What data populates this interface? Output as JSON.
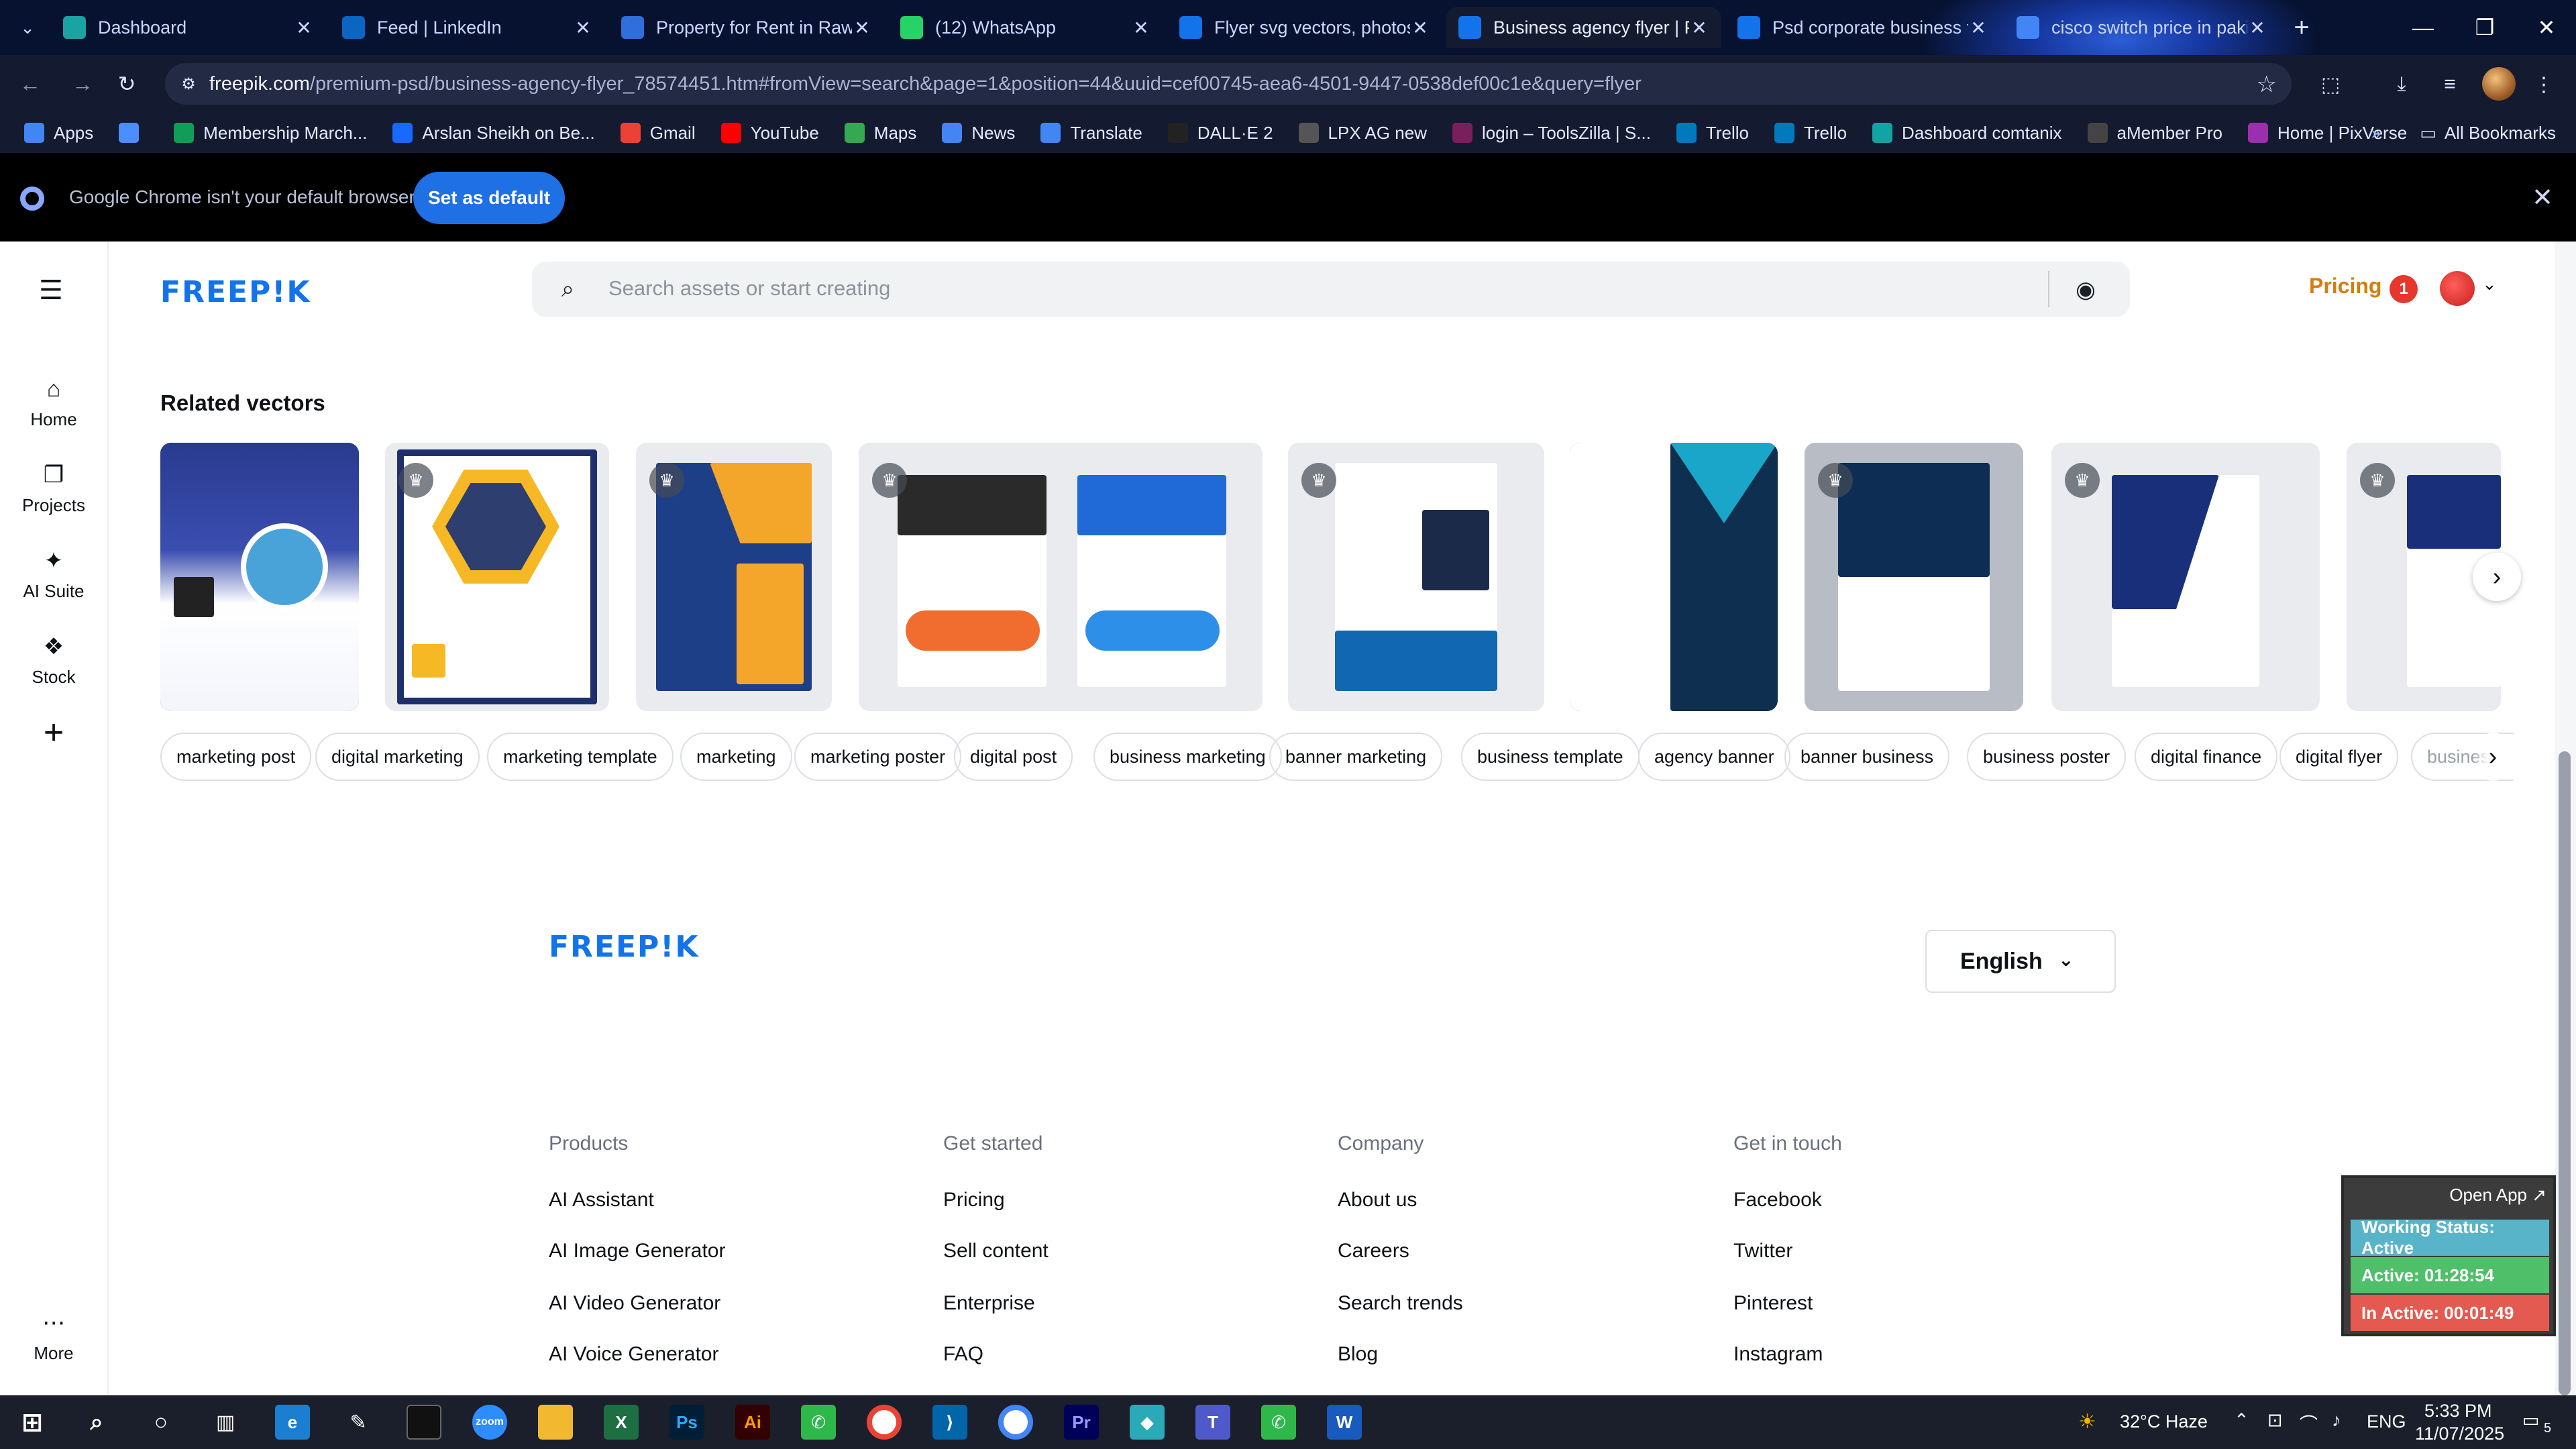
{
  "browser": {
    "tabs": [
      {
        "title": "Dashboard",
        "icon": "globe-icon",
        "color": "#1aa3a3"
      },
      {
        "title": "Feed | LinkedIn",
        "icon": "linkedin-icon",
        "color": "#0a66c2"
      },
      {
        "title": "Property for Rent in Rawa",
        "icon": "zameen-icon",
        "color": "#2f6edb"
      },
      {
        "title": "(12) WhatsApp",
        "icon": "whatsapp-icon",
        "color": "#25d366"
      },
      {
        "title": "Flyer svg vectors, photos",
        "icon": "freepik-icon",
        "color": "#1273eb"
      },
      {
        "title": "Business agency flyer | Pr",
        "icon": "freepik-icon",
        "color": "#1273eb"
      },
      {
        "title": "Psd corporate business fl",
        "icon": "freepik-icon",
        "color": "#1273eb"
      },
      {
        "title": "cisco switch price in paki",
        "icon": "google-icon",
        "color": "#4285f4"
      }
    ],
    "url_host": "freepik.com",
    "url_path": "/premium-psd/business-agency-flyer_78574451.htm#fromView=search&page=1&position=44&uuid=cef00745-aea6-4501-9447-0538def00c1e&query=flyer",
    "bookmarks": [
      {
        "label": "Apps",
        "icon": "apps-grid-icon",
        "color": "#4285f4"
      },
      {
        "label": "",
        "icon": "grid-icon",
        "color": "#4c8dff"
      },
      {
        "label": "Membership March...",
        "icon": "sheets-icon",
        "color": "#0f9d58"
      },
      {
        "label": "Arslan Sheikh on Be...",
        "icon": "behance-icon",
        "color": "#1769ff"
      },
      {
        "label": "Gmail",
        "icon": "gmail-icon",
        "color": "#ea4335"
      },
      {
        "label": "YouTube",
        "icon": "youtube-icon",
        "color": "#ff0000"
      },
      {
        "label": "Maps",
        "icon": "maps-icon",
        "color": "#34a853"
      },
      {
        "label": "News",
        "icon": "news-icon",
        "color": "#4285f4"
      },
      {
        "label": "Translate",
        "icon": "translate-icon",
        "color": "#4285f4"
      },
      {
        "label": "DALL·E 2",
        "icon": "openai-icon",
        "color": "#222222"
      },
      {
        "label": "LPX AG new",
        "icon": "lpx-icon",
        "color": "#555555"
      },
      {
        "label": "login – ToolsZilla | S...",
        "icon": "toolszilla-icon",
        "color": "#7a1f5c"
      },
      {
        "label": "Trello",
        "icon": "trello-icon",
        "color": "#0079bf"
      },
      {
        "label": "Trello",
        "icon": "trello-icon",
        "color": "#0079bf"
      },
      {
        "label": "Dashboard comtanix",
        "icon": "comtanix-icon",
        "color": "#12a4a4"
      },
      {
        "label": "aMember Pro",
        "icon": "amember-icon",
        "color": "#444444"
      },
      {
        "label": "Home | PixVerse",
        "icon": "pixverse-icon",
        "color": "#9b2fae"
      }
    ],
    "all_bookmarks": "All Bookmarks",
    "infobar_message": "Google Chrome isn't your default browser",
    "infobar_button": "Set as default"
  },
  "header": {
    "logo": "FREEP!K",
    "search_placeholder": "Search assets or start creating",
    "pricing": "Pricing",
    "notification_count": "1"
  },
  "left_nav": [
    {
      "label": "Home",
      "icon": "home-icon"
    },
    {
      "label": "Projects",
      "icon": "projects-icon"
    },
    {
      "label": "AI Suite",
      "icon": "ai-suite-icon"
    },
    {
      "label": "Stock",
      "icon": "stock-icon"
    },
    {
      "label": "",
      "icon": "plus-icon"
    },
    {
      "label": "More",
      "icon": "more-icon"
    }
  ],
  "related": {
    "title": "Related vectors",
    "tags": [
      "marketing post",
      "digital marketing",
      "marketing template",
      "marketing",
      "marketing poster",
      "digital post",
      "business marketing",
      "banner marketing",
      "business template",
      "agency banner",
      "banner business",
      "business poster",
      "digital finance",
      "digital flyer",
      "business"
    ]
  },
  "footer": {
    "logo": "FREEP!K",
    "language": "English",
    "columns": [
      {
        "heading": "Products",
        "links": [
          "AI Assistant",
          "AI Image Generator",
          "AI Video Generator",
          "AI Voice Generator"
        ]
      },
      {
        "heading": "Get started",
        "links": [
          "Pricing",
          "Sell content",
          "Enterprise",
          "FAQ"
        ]
      },
      {
        "heading": "Company",
        "links": [
          "About us",
          "Careers",
          "Search trends",
          "Blog"
        ]
      },
      {
        "heading": "Get in touch",
        "links": [
          "Facebook",
          "Twitter",
          "Pinterest",
          "Instagram"
        ]
      }
    ]
  },
  "tracker": {
    "open_app": "Open App ↗",
    "working_status": "Working Status: Active",
    "active": "Active: 01:28:54",
    "inactive": "In Active: 00:01:49",
    "colors": {
      "status": "#58b4c8",
      "active": "#4fbf6a",
      "inactive": "#e55a50"
    }
  },
  "taskbar": {
    "weather": "32°C Haze",
    "language": "ENG",
    "time": "5:33 PM",
    "date": "11/07/2025",
    "notification_count": "5"
  }
}
